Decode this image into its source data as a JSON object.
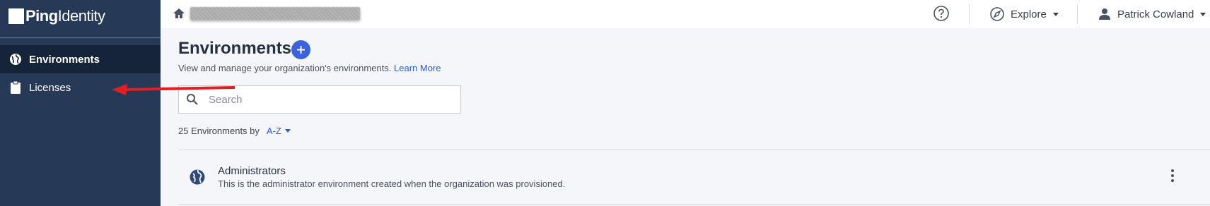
{
  "brand": {
    "logo_bold": "Ping",
    "logo_light": "Identity"
  },
  "sidebar": {
    "items": [
      {
        "label": "Environments",
        "icon": "globe-icon",
        "active": true
      },
      {
        "label": "Licenses",
        "icon": "clipboard-icon",
        "active": false
      }
    ]
  },
  "topbar": {
    "home_icon": "home-icon",
    "help_icon": "help-icon",
    "explore_label": "Explore",
    "explore_icon": "compass-icon",
    "user_name": "Patrick Cowland",
    "user_icon": "user-icon"
  },
  "main": {
    "title": "Environments",
    "add_icon": "plus-icon",
    "subtitle": "View and manage your organization's environments.",
    "learn_more": "Learn More",
    "search": {
      "placeholder": "Search",
      "value": ""
    },
    "count_text": "25 Environments by",
    "sort_label": "A-Z",
    "environments": [
      {
        "name": "Administrators",
        "description": "This is the administrator environment created when the organization was provisioned.",
        "icon": "globe-icon"
      }
    ]
  },
  "colors": {
    "sidebar_bg": "#263956",
    "sidebar_active": "#152438",
    "accent": "#3b63e0",
    "link": "#2b5bd6",
    "annotation_arrow": "#e02020"
  }
}
